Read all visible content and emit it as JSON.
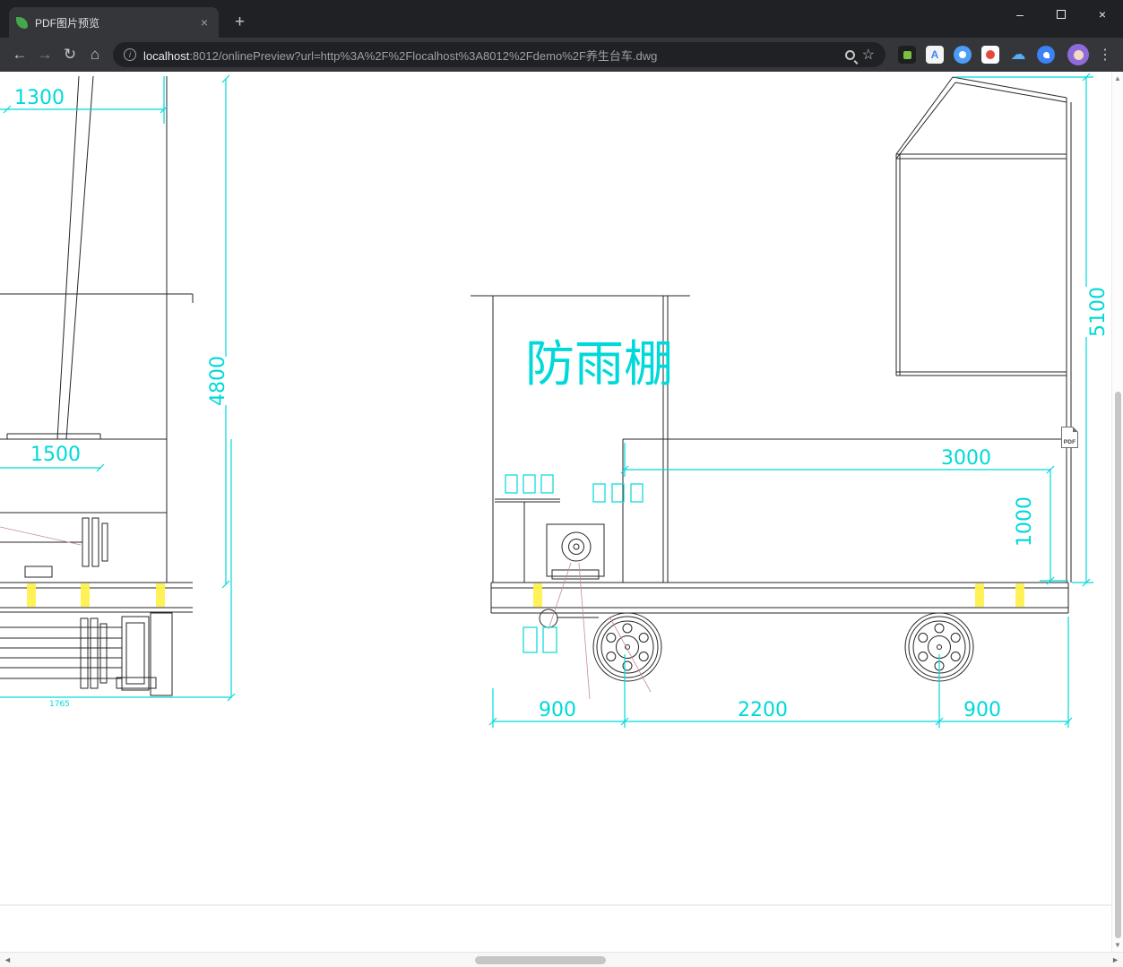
{
  "window": {
    "tab_title": "PDF图片预览",
    "tab_close": "×",
    "new_tab": "+",
    "minimize": "–",
    "close": "×"
  },
  "toolbar": {
    "back": "←",
    "forward": "→",
    "reload": "↻",
    "home": "⌂",
    "info": "i",
    "star": "☆",
    "menu": "⋮",
    "translate_glyph": "A",
    "cloud_glyph": "☁",
    "url_host": "localhost",
    "url_rest": ":8012/onlinePreview?url=http%3A%2F%2Flocalhost%3A8012%2Fdemo%2F养生台车.dwg"
  },
  "scrollbar": {
    "up": "▲",
    "down": "▼",
    "left": "◄",
    "right": "►"
  },
  "drawing": {
    "shelter_label": "防雨棚",
    "pdf_button_label": "PDF",
    "dims": {
      "d1300": "1300",
      "d4800": "4800",
      "d1500": "1500",
      "d1765": "1765",
      "d5100": "5100",
      "d3000": "3000",
      "d1000": "1000",
      "d900_left": "900",
      "d2200": "2200",
      "d900_right": "900"
    },
    "colors": {
      "dimension": "#00d9d9",
      "line": "#262626",
      "highlight": "#fff04d",
      "construction": "#c98a9a",
      "page_edge": "#dddddd"
    }
  }
}
